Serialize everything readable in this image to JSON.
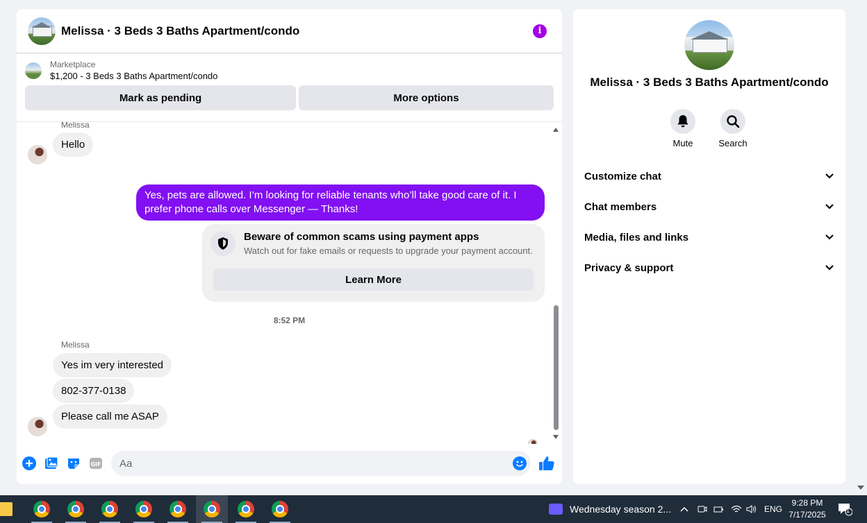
{
  "chat": {
    "title": "Melissa · 3 Beds 3 Baths Apartment/condo",
    "listing": {
      "label": "Marketplace",
      "price_title": "$1,200 - 3 Beds 3 Baths Apartment/condo",
      "mark_pending": "Mark as pending",
      "more_options": "More options"
    },
    "messages": [
      {
        "sender": "Melissa",
        "text": "Hello"
      },
      {
        "sender": "me",
        "text": "Yes, pets are allowed. I’m looking for reliable tenants who’ll take good care of it. I prefer phone calls over Messenger —  Thanks!"
      },
      {
        "sender": "Melissa",
        "text": "Yes im very interested"
      },
      {
        "sender": "Melissa",
        "text": "802-377-0138"
      },
      {
        "sender": "Melissa",
        "text": "Please call me ASAP"
      }
    ],
    "sender_name": "Melissa",
    "warning": {
      "title": "Beware of common scams using payment apps",
      "desc": "Watch out for fake emails or requests to upgrade your payment account.",
      "button": "Learn More"
    },
    "timestamp": "8:52 PM",
    "composer": {
      "placeholder": "Aa",
      "gif_label": "GIF"
    },
    "accent_color": "#8210f2"
  },
  "side": {
    "title": "Melissa · 3 Beds 3 Baths Apartment/condo",
    "actions": [
      {
        "label": "Mute",
        "icon": "bell-icon"
      },
      {
        "label": "Search",
        "icon": "search-icon"
      }
    ],
    "sections": [
      "Customize chat",
      "Chat members",
      "Media, files and links",
      "Privacy & support"
    ]
  },
  "taskbar": {
    "media_title": "Wednesday season 2...",
    "lang": "ENG",
    "time": "9:28 PM",
    "date": "7/17/2025",
    "notif_count": "1"
  }
}
